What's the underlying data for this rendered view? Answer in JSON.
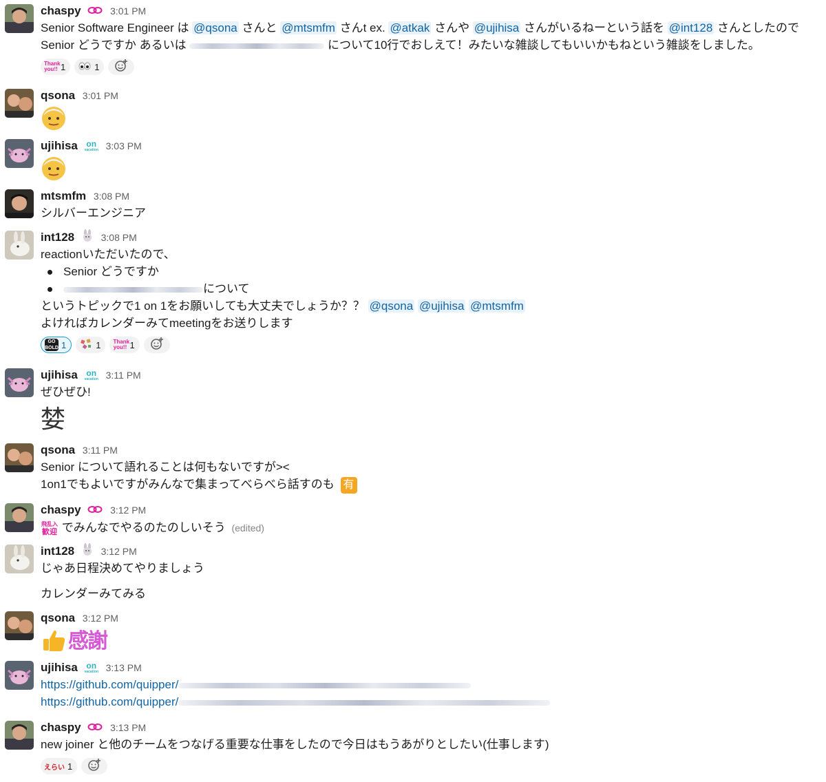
{
  "messages": [
    {
      "user": "chaspy",
      "time": "3:01 PM",
      "status": "link-emoji-icon",
      "line1": {
        "t1": "Senior Software Engineer は ",
        "m1": "@qsona",
        "t2": " さんと ",
        "m2": "@mtsmfm",
        "t3": " さんt ex. ",
        "m3": "@atkak",
        "t4": " さんや ",
        "m4": "@ujihisa",
        "t5": " さんがいるねーという話を ",
        "m5": "@int128",
        "t6": " さんとしたので"
      },
      "line2": {
        "t1": "Senior どうですか あるいは ",
        "t2": " について10行でおしえて！みたいな雑談してもいいかもねという雑談をしました。"
      },
      "reactions": [
        {
          "emoji": "thank-you-emoji",
          "label": "Thank you!!",
          "count": "1"
        },
        {
          "emoji": "eyes-emoji",
          "label": "👀",
          "count": "1"
        }
      ]
    },
    {
      "user": "qsona",
      "time": "3:01 PM",
      "emoji": "older-man-emoji"
    },
    {
      "user": "ujihisa",
      "time": "3:03 PM",
      "status_text": "on",
      "status_sub": "vacation",
      "emoji": "older-man-emoji"
    },
    {
      "user": "mtsmfm",
      "time": "3:08 PM",
      "text": "シルバーエンジニア"
    },
    {
      "user": "int128",
      "time": "3:08 PM",
      "status": "rabbit-icon",
      "line1": "reactionいただいたので、",
      "bullet1": "Senior どうですか",
      "bullet2_tail": "について",
      "line3": {
        "t1": "というトピックで1 on 1をお願いしても大丈夫でしょうか？？ ",
        "m1": "@qsona",
        "m2": "@ujihisa",
        "m3": "@mtsmfm"
      },
      "line4": "よければカレンダーみてmeetingをお送りします",
      "reactions": [
        {
          "emoji": "go-bold-emoji",
          "label": "GO BOLD",
          "count": "1"
        },
        {
          "emoji": "celebrate-emoji",
          "label": "🎊",
          "count": "1"
        },
        {
          "emoji": "thank-you-emoji",
          "label": "Thank you!!",
          "count": "1"
        }
      ]
    },
    {
      "user": "ujihisa",
      "time": "3:11 PM",
      "status_text": "on",
      "status_sub": "vacation",
      "text": "ぜひぜひ!",
      "sticker": "婪"
    },
    {
      "user": "qsona",
      "time": "3:11 PM",
      "line1": "Senior について語れることは何もないですが><",
      "line2": "1on1でもよいですがみんなで集まってべらべら話すのも",
      "badge": "有"
    },
    {
      "user": "chaspy",
      "time": "3:12 PM",
      "status": "link-emoji-icon",
      "sticker": "飛び入り歓迎",
      "sticker_l1": "飛乱入",
      "sticker_l2": "歓迎",
      "text": "でみんなでやるのたのしいそう",
      "edited": "(edited)"
    },
    {
      "user": "int128",
      "time": "3:12 PM",
      "status": "rabbit-icon",
      "line1": "じゃあ日程決めてやりましょう",
      "line2": "カレンダーみてみる"
    },
    {
      "user": "qsona",
      "time": "3:12 PM",
      "emoji": "thumbs-up-emoji",
      "big_text": "感謝"
    },
    {
      "user": "ujihisa",
      "time": "3:13 PM",
      "status_text": "on",
      "status_sub": "vacation",
      "link1": "https://github.com/quipper/",
      "link2": "https://github.com/quipper/"
    },
    {
      "user": "chaspy",
      "time": "3:13 PM",
      "status": "link-emoji-icon",
      "text": "new joiner と他のチームをつなげる重要な仕事をしたので今日はもうあがりとしたい(仕事します)",
      "reactions": [
        {
          "emoji": "erai-emoji",
          "label": "えらい",
          "count": "1"
        }
      ]
    }
  ],
  "colors": {
    "mention_bg": "#e8f2fa",
    "mention_fg": "#1264a3",
    "pink": "#e01e9b",
    "status_teal": "#2bb3c0"
  }
}
